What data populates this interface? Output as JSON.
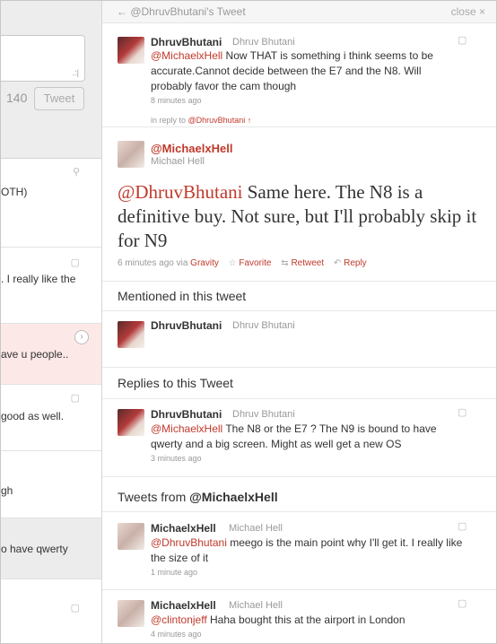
{
  "left": {
    "counter": "140",
    "tweet_button": "Tweet",
    "compose_grip": ".:|",
    "items": [
      {
        "text": "OTH)",
        "icon": "⚲"
      },
      {
        "text": ". I really like the",
        "icon": "▢"
      },
      {
        "text": "ave u people..",
        "icon": "›"
      },
      {
        "text": "good as well.",
        "icon": "▢"
      },
      {
        "text": "gh",
        "icon": ""
      },
      {
        "text": "o have qwerty",
        "icon": ""
      },
      {
        "text": "",
        "icon": "▢"
      }
    ]
  },
  "panel": {
    "back_label": "← @DhruvBhutani's Tweet",
    "close_label": "close ×",
    "original": {
      "username": "DhruvBhutani",
      "fullname": "Dhruv Bhutani",
      "mention": "@MichaelxHell",
      "text": " Now THAT is something i think seems to be accurate.Cannot decide between the E7 and the N8. Will probably favor the cam though",
      "time": "8 minutes ago"
    },
    "in_reply_prefix": "in reply to ",
    "in_reply_user": "@DhruvBhutani",
    "in_reply_arrow": "↑",
    "main": {
      "username": "@MichaelxHell",
      "fullname": "Michael Hell",
      "mention": "@DhruvBhutani",
      "text": " Same here. The N8 is a definitive buy. Not sure, but I'll probably skip it for N9",
      "time": "6 minutes ago",
      "via": " via ",
      "client": "Gravity",
      "favorite": "Favorite",
      "retweet": "Retweet",
      "reply": "Reply"
    },
    "mentioned_heading": "Mentioned in this tweet",
    "mentioned": {
      "username": "DhruvBhutani",
      "fullname": "Dhruv Bhutani"
    },
    "replies_heading": "Replies to this Tweet",
    "reply1": {
      "username": "DhruvBhutani",
      "fullname": "Dhruv Bhutani",
      "mention": "@MichaelxHell",
      "text": " The N8 or the E7 ? The N9 is bound to have qwerty and a big screen. Might as well get a new OS",
      "time": "3 minutes ago"
    },
    "from_heading_prefix": "Tweets from ",
    "from_heading_user": "@MichaelxHell",
    "from1": {
      "username": "MichaelxHell",
      "fullname": "Michael Hell",
      "mention": "@DhruvBhutani",
      "text": " meego is the main point why I'll get it. I really like the size of it",
      "time": "1 minute ago"
    },
    "from2": {
      "username": "MichaelxHell",
      "fullname": "Michael Hell",
      "mention": "@clintonjeff",
      "text": " Haha bought this at the airport in London",
      "time": "4 minutes ago"
    }
  }
}
